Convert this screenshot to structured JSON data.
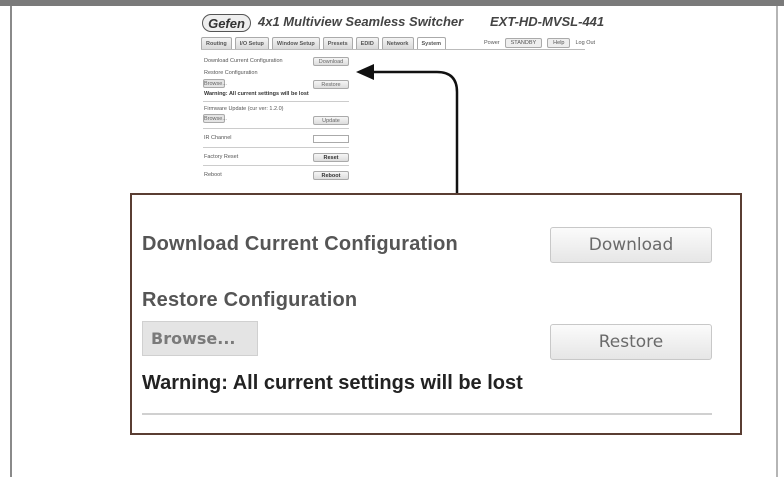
{
  "header": {
    "logo": "Gefen",
    "title": "4x1 Multiview Seamless Switcher",
    "model": "EXT-HD-MVSL-441"
  },
  "tabs": [
    {
      "label": "Routing"
    },
    {
      "label": "I/O Setup"
    },
    {
      "label": "Window Setup"
    },
    {
      "label": "Presets"
    },
    {
      "label": "EDID"
    },
    {
      "label": "Network"
    },
    {
      "label": "System"
    }
  ],
  "topbar": {
    "power_label": "Power",
    "power_value": "STANDBY",
    "help": "Help",
    "logout": "Log Out"
  },
  "small_panel": {
    "download_label": "Download Current Configuration",
    "download_button": "Download",
    "restore_label": "Restore Configuration",
    "browse_button": "Browse...",
    "restore_button": "Restore",
    "warning": "Warning: All current settings will be lost",
    "firmware_label": "Firmware Update (cur ver: 1.2.0)",
    "update_button": "Update",
    "ir_label": "IR Channel",
    "factory_label": "Factory Reset",
    "reset_button": "Reset",
    "reboot_label": "Reboot",
    "reboot_button": "Reboot"
  },
  "zoom": {
    "download_label": "Download Current Configuration",
    "download_button": "Download",
    "restore_label": "Restore Configuration",
    "browse_button": "Browse...",
    "restore_button": "Restore",
    "warning": "Warning: All current settings will be lost"
  },
  "colors": {
    "callout_border": "#5a3e33",
    "arrow": "#111111"
  }
}
